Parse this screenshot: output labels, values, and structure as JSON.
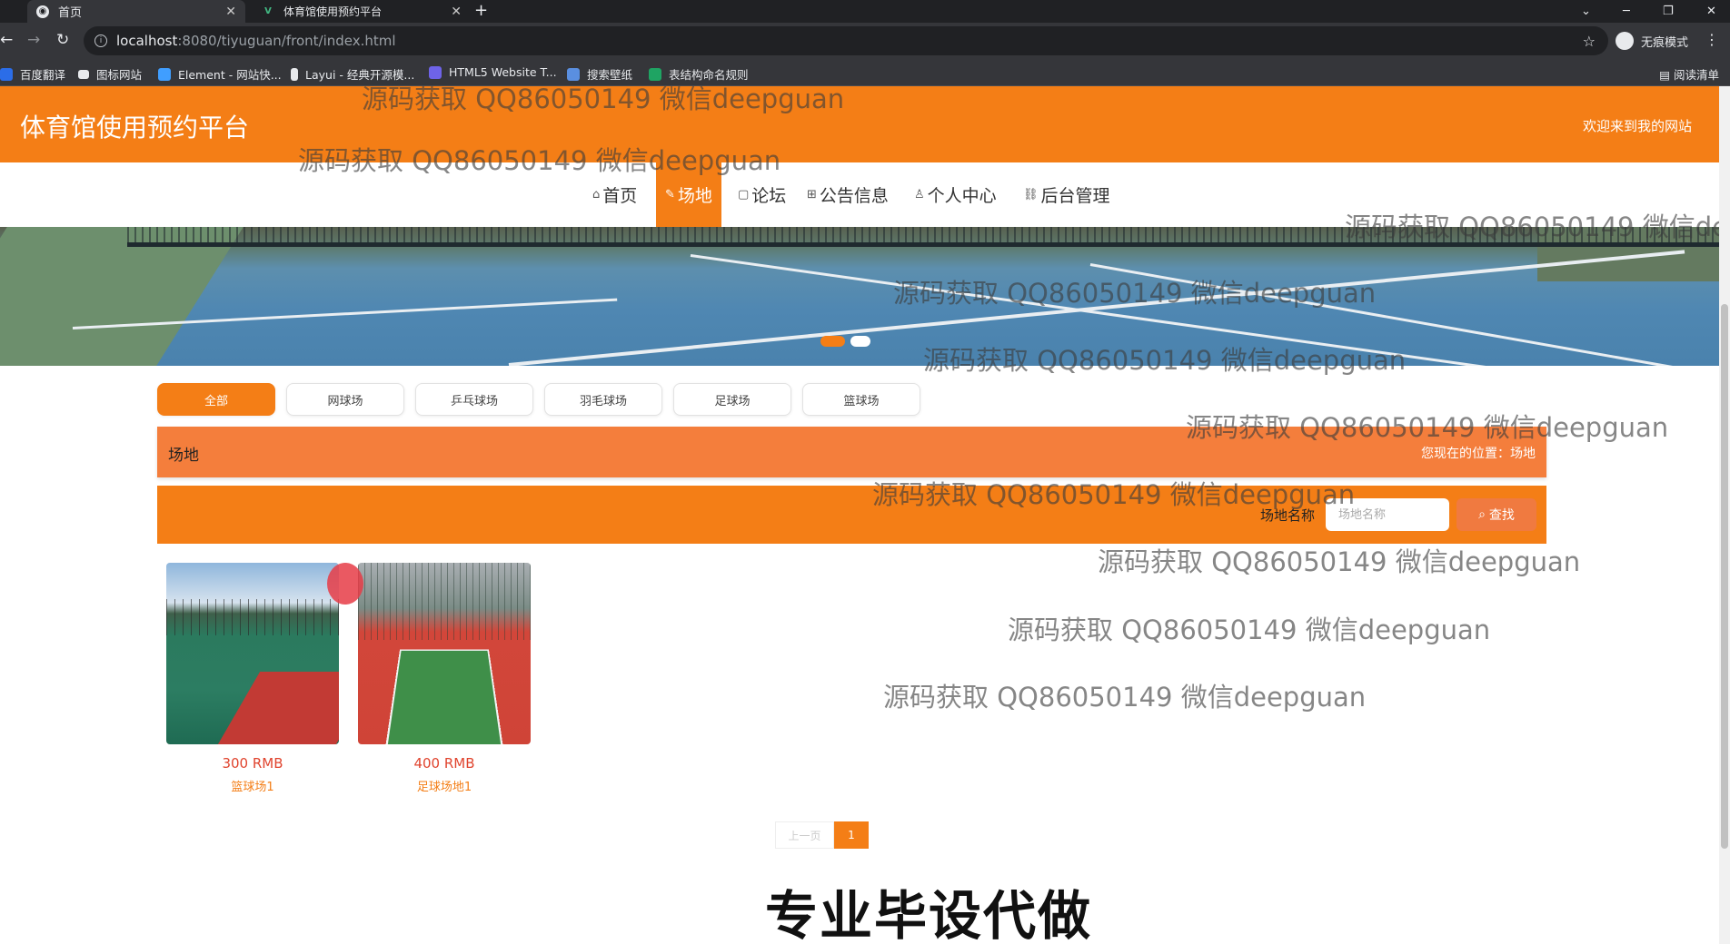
{
  "browser": {
    "tabs": [
      {
        "title": "首页",
        "active": true
      },
      {
        "title": "体育馆使用预约平台",
        "active": false
      }
    ],
    "url_host": "localhost",
    "url_path": ":8080/tiyuguan/front/index.html",
    "incognito_label": "无痕模式",
    "bookmarks": [
      "百度翻译",
      "图标网站",
      "Element - 网站快...",
      "Layui - 经典开源模...",
      "HTML5 Website T...",
      "搜索壁纸",
      "表结构命名规则"
    ],
    "reading_list": "阅读清单"
  },
  "site": {
    "title": "体育馆使用预约平台",
    "welcome": "欢迎来到我的网站"
  },
  "nav": [
    {
      "label": "首页",
      "icon": "home-icon"
    },
    {
      "label": "场地",
      "icon": "edit-icon",
      "active": true
    },
    {
      "label": "论坛",
      "icon": "book-icon"
    },
    {
      "label": "公告信息",
      "icon": "grid-icon"
    },
    {
      "label": "个人中心",
      "icon": "user-icon"
    },
    {
      "label": "后台管理",
      "icon": "link-icon"
    }
  ],
  "filters": [
    "全部",
    "网球场",
    "乒乓球场",
    "羽毛球场",
    "足球场",
    "篮球场"
  ],
  "breadcrumb": {
    "section": "场地",
    "location": "您现在的位置：场地"
  },
  "search": {
    "label": "场地名称",
    "placeholder": "场地名称",
    "button": "查找"
  },
  "venues": [
    {
      "price": "300 RMB",
      "name": "篮球场1"
    },
    {
      "price": "400 RMB",
      "name": "足球场地1"
    }
  ],
  "pager": {
    "prev": "上一页",
    "current": "1"
  },
  "watermark": "源码获取 QQ86050149 微信deepguan",
  "promo": "专业毕设代做",
  "colors": {
    "accent": "#f47e16",
    "price": "#e0442e"
  }
}
